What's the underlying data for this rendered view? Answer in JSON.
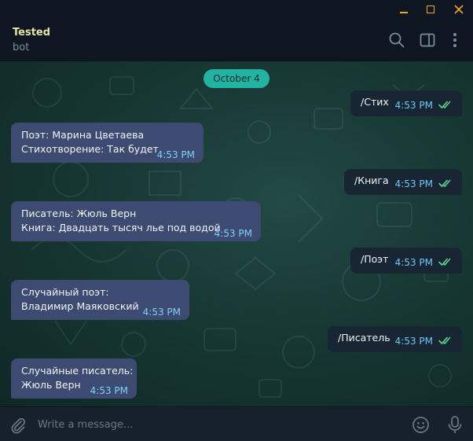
{
  "window": {
    "controls": [
      "minimize",
      "maximize",
      "close"
    ],
    "accent": "#f5a623"
  },
  "header": {
    "chat_name": "Tested",
    "chat_status": "bot",
    "icons": [
      "search-icon",
      "sidebar-panel-icon",
      "more-vertical-icon"
    ]
  },
  "chat": {
    "date": "October 4",
    "messages": [
      {
        "dir": "out",
        "text": [
          "/Стих"
        ],
        "time": "4:53 PM",
        "read": true
      },
      {
        "dir": "in",
        "text": [
          "Поэт: Марина Цветаева",
          "Стихотворение: Так будет"
        ],
        "time": "4:53 PM"
      },
      {
        "dir": "out",
        "text": [
          "/Книга"
        ],
        "time": "4:53 PM",
        "read": true
      },
      {
        "dir": "in",
        "text": [
          "Писатель: Жюль Верн",
          "Книга: Двадцать тысяч лье под водой"
        ],
        "time": "4:53 PM"
      },
      {
        "dir": "out",
        "text": [
          "/Поэт"
        ],
        "time": "4:53 PM",
        "read": true
      },
      {
        "dir": "in",
        "text": [
          "Случайный поэт:",
          "Владимир Маяковский"
        ],
        "time": "4:53 PM"
      },
      {
        "dir": "out",
        "text": [
          "/Писатель"
        ],
        "time": "4:53 PM",
        "read": true
      },
      {
        "dir": "in",
        "text": [
          "Случайные писатель:",
          "Жюль Верн"
        ],
        "time": "4:53 PM"
      }
    ]
  },
  "composer": {
    "placeholder": "Write a message...",
    "value": "",
    "icons": [
      "attach-icon",
      "emoji-icon",
      "microphone-icon"
    ]
  },
  "colors": {
    "bubble_in": "#3d4a72",
    "bubble_out": "#182533",
    "date_pill": "#23b3a3",
    "check": "#5fd38d",
    "time_in": "#7dd3f6"
  }
}
